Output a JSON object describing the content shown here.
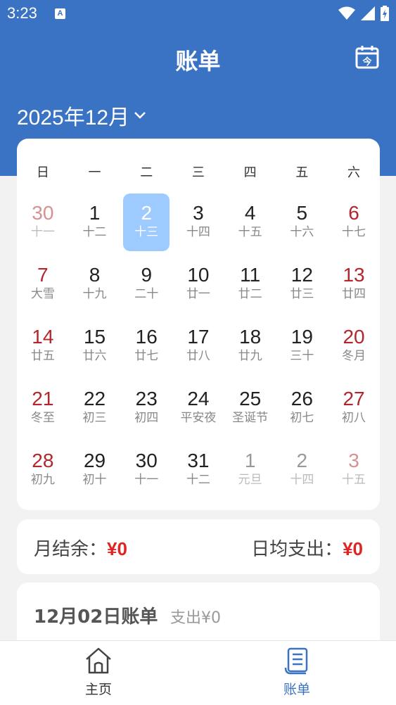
{
  "status_bar": {
    "time": "3:23",
    "a_badge": "A"
  },
  "header": {
    "title": "账单",
    "calendar_icon_text": "今",
    "month_label": "2025年12月"
  },
  "weekdays": [
    "日",
    "一",
    "二",
    "三",
    "四",
    "五",
    "六"
  ],
  "days": [
    {
      "num": "30",
      "lunar": "十一",
      "weekend": true,
      "other": true
    },
    {
      "num": "1",
      "lunar": "十二"
    },
    {
      "num": "2",
      "lunar": "十三",
      "selected": true
    },
    {
      "num": "3",
      "lunar": "十四"
    },
    {
      "num": "4",
      "lunar": "十五"
    },
    {
      "num": "5",
      "lunar": "十六"
    },
    {
      "num": "6",
      "lunar": "十七",
      "weekend": true
    },
    {
      "num": "7",
      "lunar": "大雪",
      "weekend": true
    },
    {
      "num": "8",
      "lunar": "十九"
    },
    {
      "num": "9",
      "lunar": "二十"
    },
    {
      "num": "10",
      "lunar": "廿一"
    },
    {
      "num": "11",
      "lunar": "廿二"
    },
    {
      "num": "12",
      "lunar": "廿三"
    },
    {
      "num": "13",
      "lunar": "廿四",
      "weekend": true
    },
    {
      "num": "14",
      "lunar": "廿五",
      "weekend": true
    },
    {
      "num": "15",
      "lunar": "廿六"
    },
    {
      "num": "16",
      "lunar": "廿七"
    },
    {
      "num": "17",
      "lunar": "廿八"
    },
    {
      "num": "18",
      "lunar": "廿九"
    },
    {
      "num": "19",
      "lunar": "三十"
    },
    {
      "num": "20",
      "lunar": "冬月",
      "weekend": true
    },
    {
      "num": "21",
      "lunar": "冬至",
      "weekend": true
    },
    {
      "num": "22",
      "lunar": "初三"
    },
    {
      "num": "23",
      "lunar": "初四"
    },
    {
      "num": "24",
      "lunar": "平安夜"
    },
    {
      "num": "25",
      "lunar": "圣诞节"
    },
    {
      "num": "26",
      "lunar": "初七"
    },
    {
      "num": "27",
      "lunar": "初八",
      "weekend": true
    },
    {
      "num": "28",
      "lunar": "初九",
      "weekend": true
    },
    {
      "num": "29",
      "lunar": "初十"
    },
    {
      "num": "30",
      "lunar": "十一"
    },
    {
      "num": "31",
      "lunar": "十二"
    },
    {
      "num": "1",
      "lunar": "元旦",
      "other": true
    },
    {
      "num": "2",
      "lunar": "十四",
      "other": true
    },
    {
      "num": "3",
      "lunar": "十五",
      "weekend": true,
      "other": true
    }
  ],
  "summary": {
    "balance_label": "月结余：",
    "balance_value": "¥0",
    "avg_label": "日均支出：",
    "avg_value": "¥0"
  },
  "bill": {
    "title": "12月02日账单",
    "subtitle": "支出¥0"
  },
  "nav": {
    "home_label": "主页",
    "bill_label": "账单"
  },
  "colors": {
    "primary": "#3a72c4",
    "weekend": "#b3262b",
    "selected": "#9ecbff",
    "money": "#e02424"
  }
}
